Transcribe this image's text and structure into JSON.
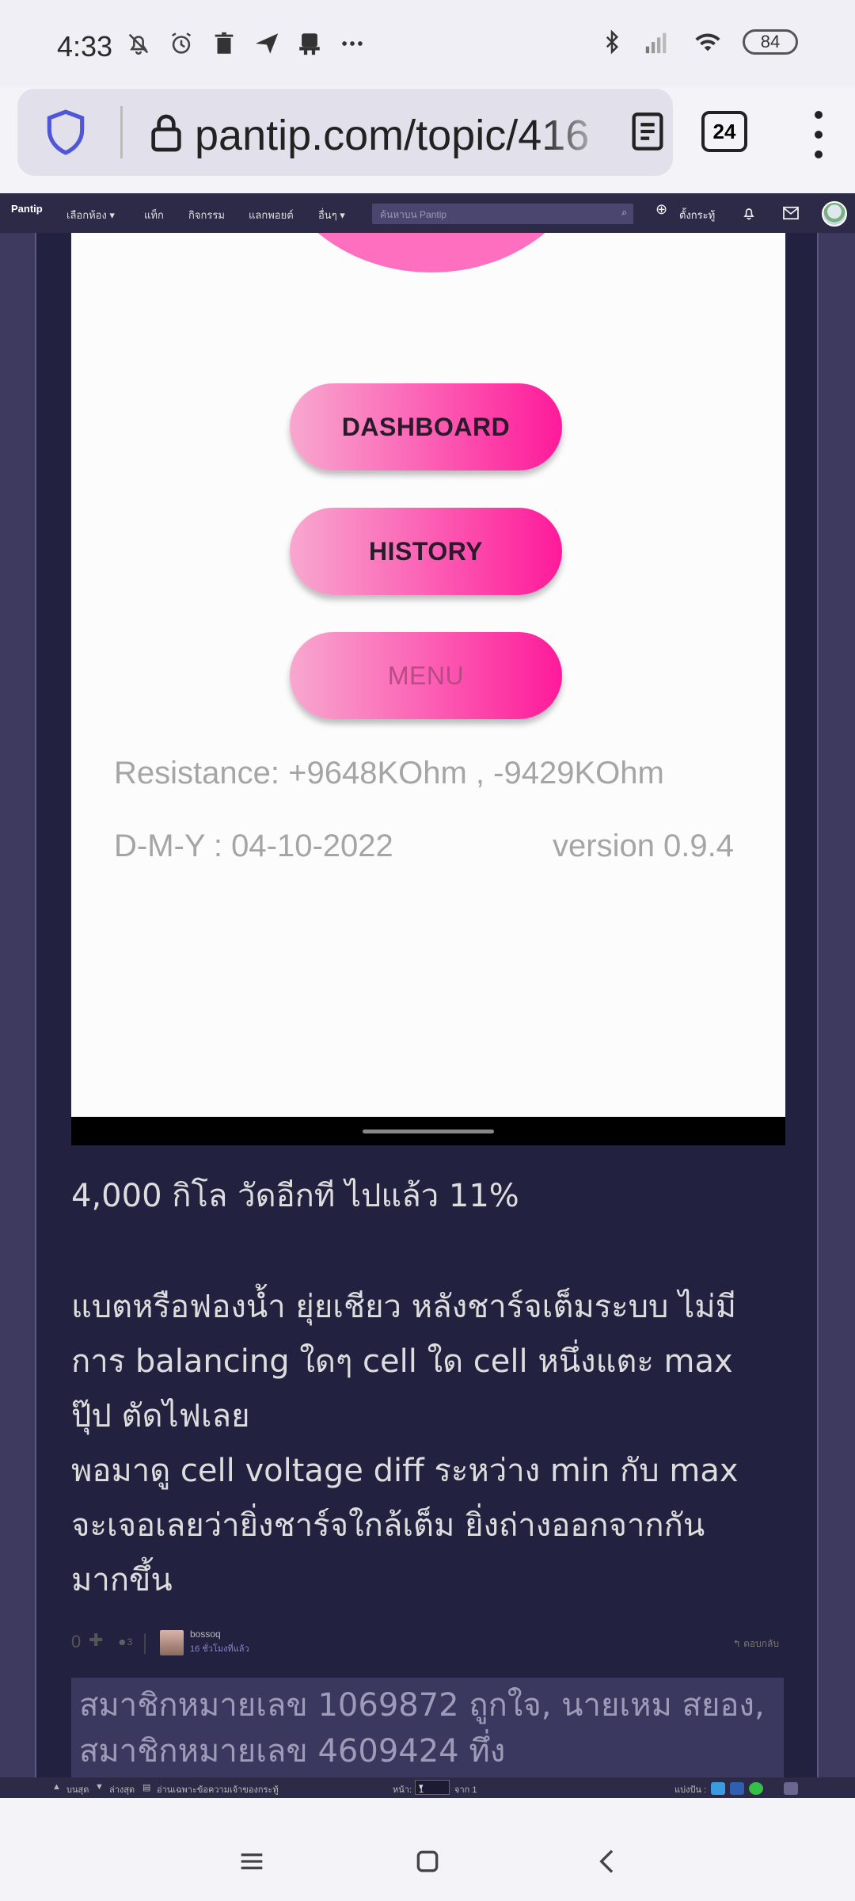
{
  "status_bar": {
    "time": "4:33",
    "battery": "84",
    "icons_left": [
      "mute-bell-icon",
      "alarm-icon",
      "trash-icon",
      "send-icon",
      "bot-icon",
      "more-dots-icon"
    ],
    "icons_right": [
      "bluetooth-icon",
      "signal-icon",
      "wifi-icon",
      "battery-icon"
    ]
  },
  "browser": {
    "url": "pantip.com/topic/416",
    "tab_count": "24"
  },
  "pantip_nav": {
    "logo": "Pantip",
    "items": [
      "เลือกห้อง ▾",
      "แท็ก",
      "กิจกรรม",
      "แลกพอยต์",
      "อื่นๆ ▾"
    ],
    "search_placeholder": "ค้นหาบน Pantip",
    "new_topic": "ตั้งกระทู้"
  },
  "app_screenshot": {
    "buttons": [
      "DASHBOARD",
      "HISTORY",
      "MENU"
    ],
    "resistance": "Resistance: +9648KOhm , -9429KOhm",
    "date": "D-M-Y : 04-10-2022",
    "version": "version 0.9.4"
  },
  "post": {
    "line1": "4,000 กิโล วัดอีกที ไปแล้ว 11%",
    "para2_line1": "แบตหรือฟองน้ำ ยุ่ยเชียว หลังชาร์จเต็มระบบ ไม่มี",
    "para2_line2": "การ balancing ใดๆ cell ใด cell หนึ่งแตะ max",
    "para2_line3": "ปุ๊ป ตัดไฟเลย",
    "para2_line4": "พอมาดู cell voltage diff ระหว่าง min กับ max",
    "para2_line5": "จะเจอเลยว่ายิ่งชาร์จใกล้เต็ม ยิ่งถ่างออกจากกัน",
    "para2_line6": "มากขึ้น"
  },
  "meta": {
    "score": "0",
    "emotion_count": "3",
    "username": "bossoq",
    "time": "16 ชั่วโมงที่แล้ว",
    "reply": "ตอบกลับ"
  },
  "likes": {
    "line1": "สมาชิกหมายเลข 1069872 ถูกใจ, นายเหม สยอง,",
    "line2": "สมาชิกหมายเลข 4609424 ทึ่ง"
  },
  "bottom_bar": {
    "top": "บนสุด",
    "bottom": "ล่างสุด",
    "owner_only": "อ่านเฉพาะข้อความเจ้าของกระทู้",
    "page_label": "หน้า:",
    "page_value": "1",
    "of_label": "จาก 1",
    "share_label": "แบ่งปัน :"
  }
}
